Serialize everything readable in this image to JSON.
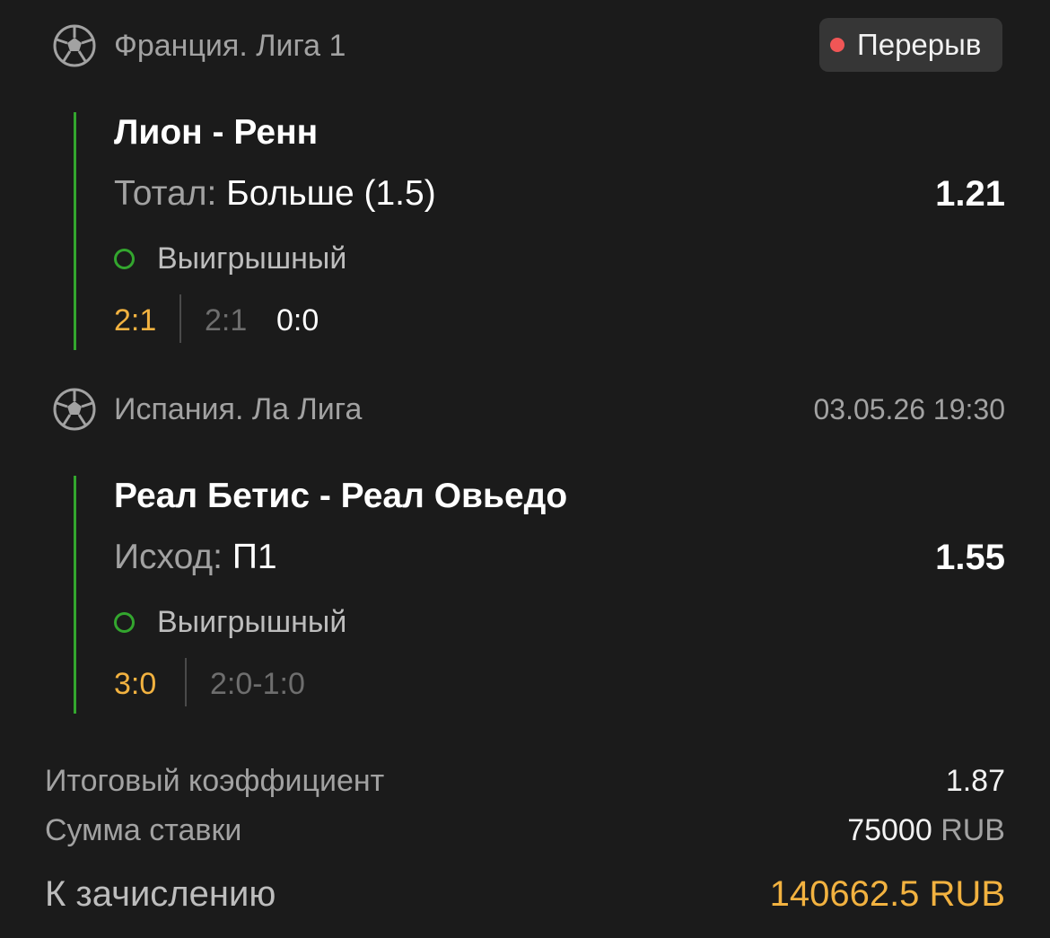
{
  "events": [
    {
      "league": "Франция. Лига 1",
      "status": "Перерыв",
      "match": "Лион - Ренн",
      "market_label": "Тотал:",
      "market_value": "Больше (1.5)",
      "odds": "1.21",
      "result": "Выигрышный",
      "score": "2:1",
      "score_half": "2:1",
      "score_extra": "0:0"
    },
    {
      "league": "Испания. Ла Лига",
      "datetime": "03.05.26 19:30",
      "match": "Реал Бетис - Реал Овьедо",
      "market_label": "Исход:",
      "market_value": "П1",
      "odds": "1.55",
      "result": "Выигрышный",
      "score": "3:0",
      "score_half": "2:0-1:0"
    }
  ],
  "summary": {
    "total_odds_label": "Итоговый коэффициент",
    "total_odds_value": "1.87",
    "stake_label": "Сумма ставки",
    "stake_amount": "75000",
    "stake_currency": "RUB",
    "payout_label": "К зачислению",
    "payout_value": "140662.5 RUB"
  },
  "colors": {
    "background": "#1b1b1b",
    "accent_gold": "#f2b240",
    "win_green": "#33a62e",
    "live_red": "#f05656"
  },
  "icons": {
    "sport": "soccer-ball-icon",
    "result": "win-circle-icon",
    "status": "live-dot-icon"
  }
}
